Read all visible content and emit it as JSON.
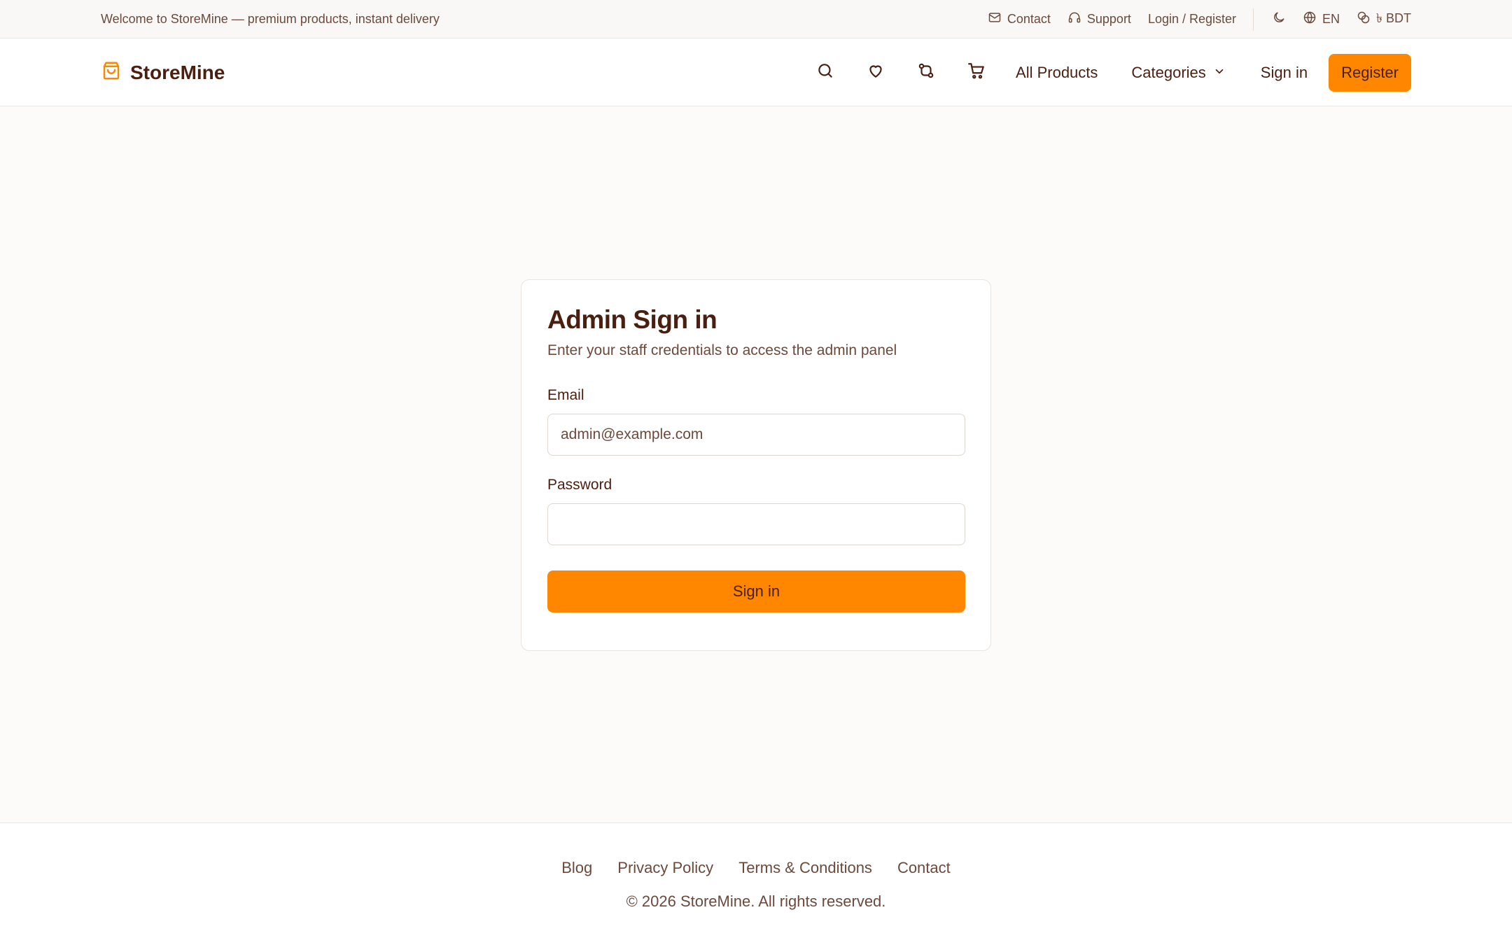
{
  "topbar": {
    "welcome": "Welcome to StoreMine — premium products, instant delivery",
    "contact": "Contact",
    "support": "Support",
    "login_register": "Login / Register",
    "language": "EN",
    "currency": "৳ BDT"
  },
  "header": {
    "brand": "StoreMine",
    "all_products": "All Products",
    "categories": "Categories",
    "sign_in": "Sign in",
    "register": "Register"
  },
  "card": {
    "title": "Admin Sign in",
    "subtitle": "Enter your staff credentials to access the admin panel",
    "email_label": "Email",
    "email_placeholder": "admin@example.com",
    "password_label": "Password",
    "submit": "Sign in"
  },
  "footer": {
    "links": [
      "Blog",
      "Privacy Policy",
      "Terms & Conditions",
      "Contact"
    ],
    "copyright": "© 2026 StoreMine. All rights reserved."
  },
  "colors": {
    "accent": "#ff8700",
    "text": "#4a1f10",
    "muted": "#6b4a3c",
    "background": "#fcfbf9"
  }
}
